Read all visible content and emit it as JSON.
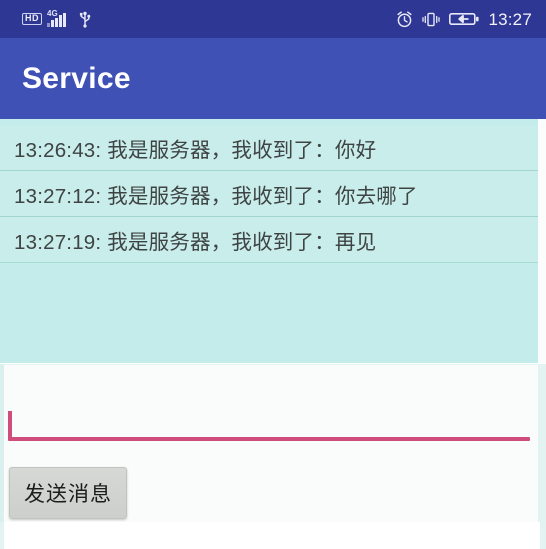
{
  "status_bar": {
    "background": "#2f3794",
    "hd_label": "HD",
    "network_label": "4G",
    "icons": [
      "hd-badge-icon",
      "signal-bars-icon",
      "usb-icon",
      "alarm-clock-icon",
      "vibrate-icon",
      "battery-charging-icon"
    ],
    "clock": "13:27"
  },
  "app_bar": {
    "title": "Service",
    "background": "#3f51b5"
  },
  "messages": {
    "background": "#c3ecea",
    "items": [
      {
        "text": "13:26:43: 我是服务器，我收到了：你好"
      },
      {
        "text": "13:27:12: 我是服务器，我收到了：你去哪了"
      },
      {
        "text": "13:27:19: 我是服务器，我收到了：再见"
      }
    ]
  },
  "input_area": {
    "message_input": {
      "value": "",
      "placeholder": "",
      "underline_color": "#cf4d7d",
      "caret_color": "#cf4d7d"
    },
    "send_button": {
      "label": "发送消息"
    }
  }
}
